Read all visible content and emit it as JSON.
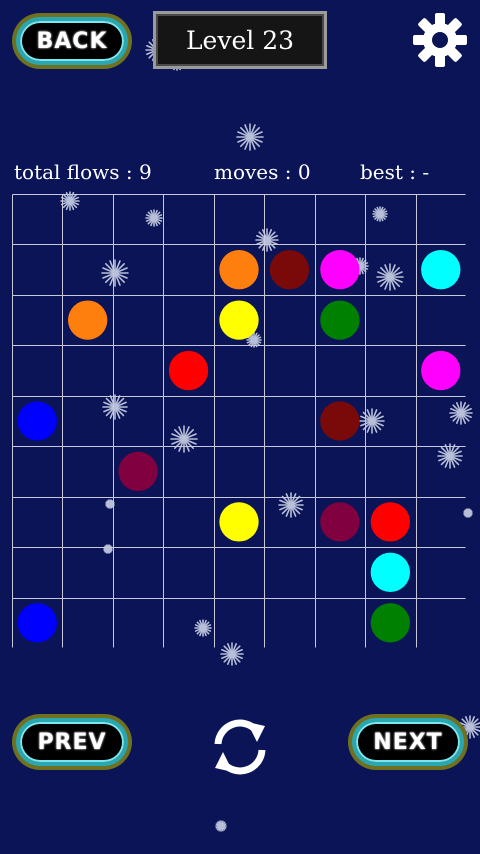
{
  "header": {
    "back_label": "BACK",
    "level_label": "Level  23",
    "settings_icon": "gear-icon"
  },
  "stats": {
    "total_flows": "total flows : 9",
    "moves": "moves : 0",
    "best": "best : -"
  },
  "board": {
    "rows": 9,
    "cols": 9,
    "grid_color": "#c8c8d8",
    "dots": [
      {
        "row": 1,
        "col": 4,
        "color": "#ff7f0e"
      },
      {
        "row": 1,
        "col": 5,
        "color": "#7a0a0a"
      },
      {
        "row": 1,
        "col": 6,
        "color": "#ff00ff"
      },
      {
        "row": 1,
        "col": 8,
        "color": "#00ffff"
      },
      {
        "row": 2,
        "col": 1,
        "color": "#ff7f0e"
      },
      {
        "row": 2,
        "col": 4,
        "color": "#ffff00"
      },
      {
        "row": 2,
        "col": 6,
        "color": "#008000"
      },
      {
        "row": 3,
        "col": 3,
        "color": "#ff0000"
      },
      {
        "row": 3,
        "col": 8,
        "color": "#ff00ff"
      },
      {
        "row": 4,
        "col": 0,
        "color": "#0000ff"
      },
      {
        "row": 4,
        "col": 6,
        "color": "#7a0a0a"
      },
      {
        "row": 5,
        "col": 2,
        "color": "#800040"
      },
      {
        "row": 6,
        "col": 4,
        "color": "#ffff00"
      },
      {
        "row": 6,
        "col": 6,
        "color": "#800040"
      },
      {
        "row": 6,
        "col": 7,
        "color": "#ff0000"
      },
      {
        "row": 7,
        "col": 7,
        "color": "#00ffff"
      },
      {
        "row": 8,
        "col": 0,
        "color": "#0000ff"
      },
      {
        "row": 8,
        "col": 7,
        "color": "#008000"
      }
    ]
  },
  "footer": {
    "prev_label": "PREV",
    "next_label": "NEXT",
    "restart_icon": "restart-icon"
  },
  "colors": {
    "background": "#0a1456",
    "button_outer": "#6f7020",
    "button_ring": "#2aa6b0"
  }
}
